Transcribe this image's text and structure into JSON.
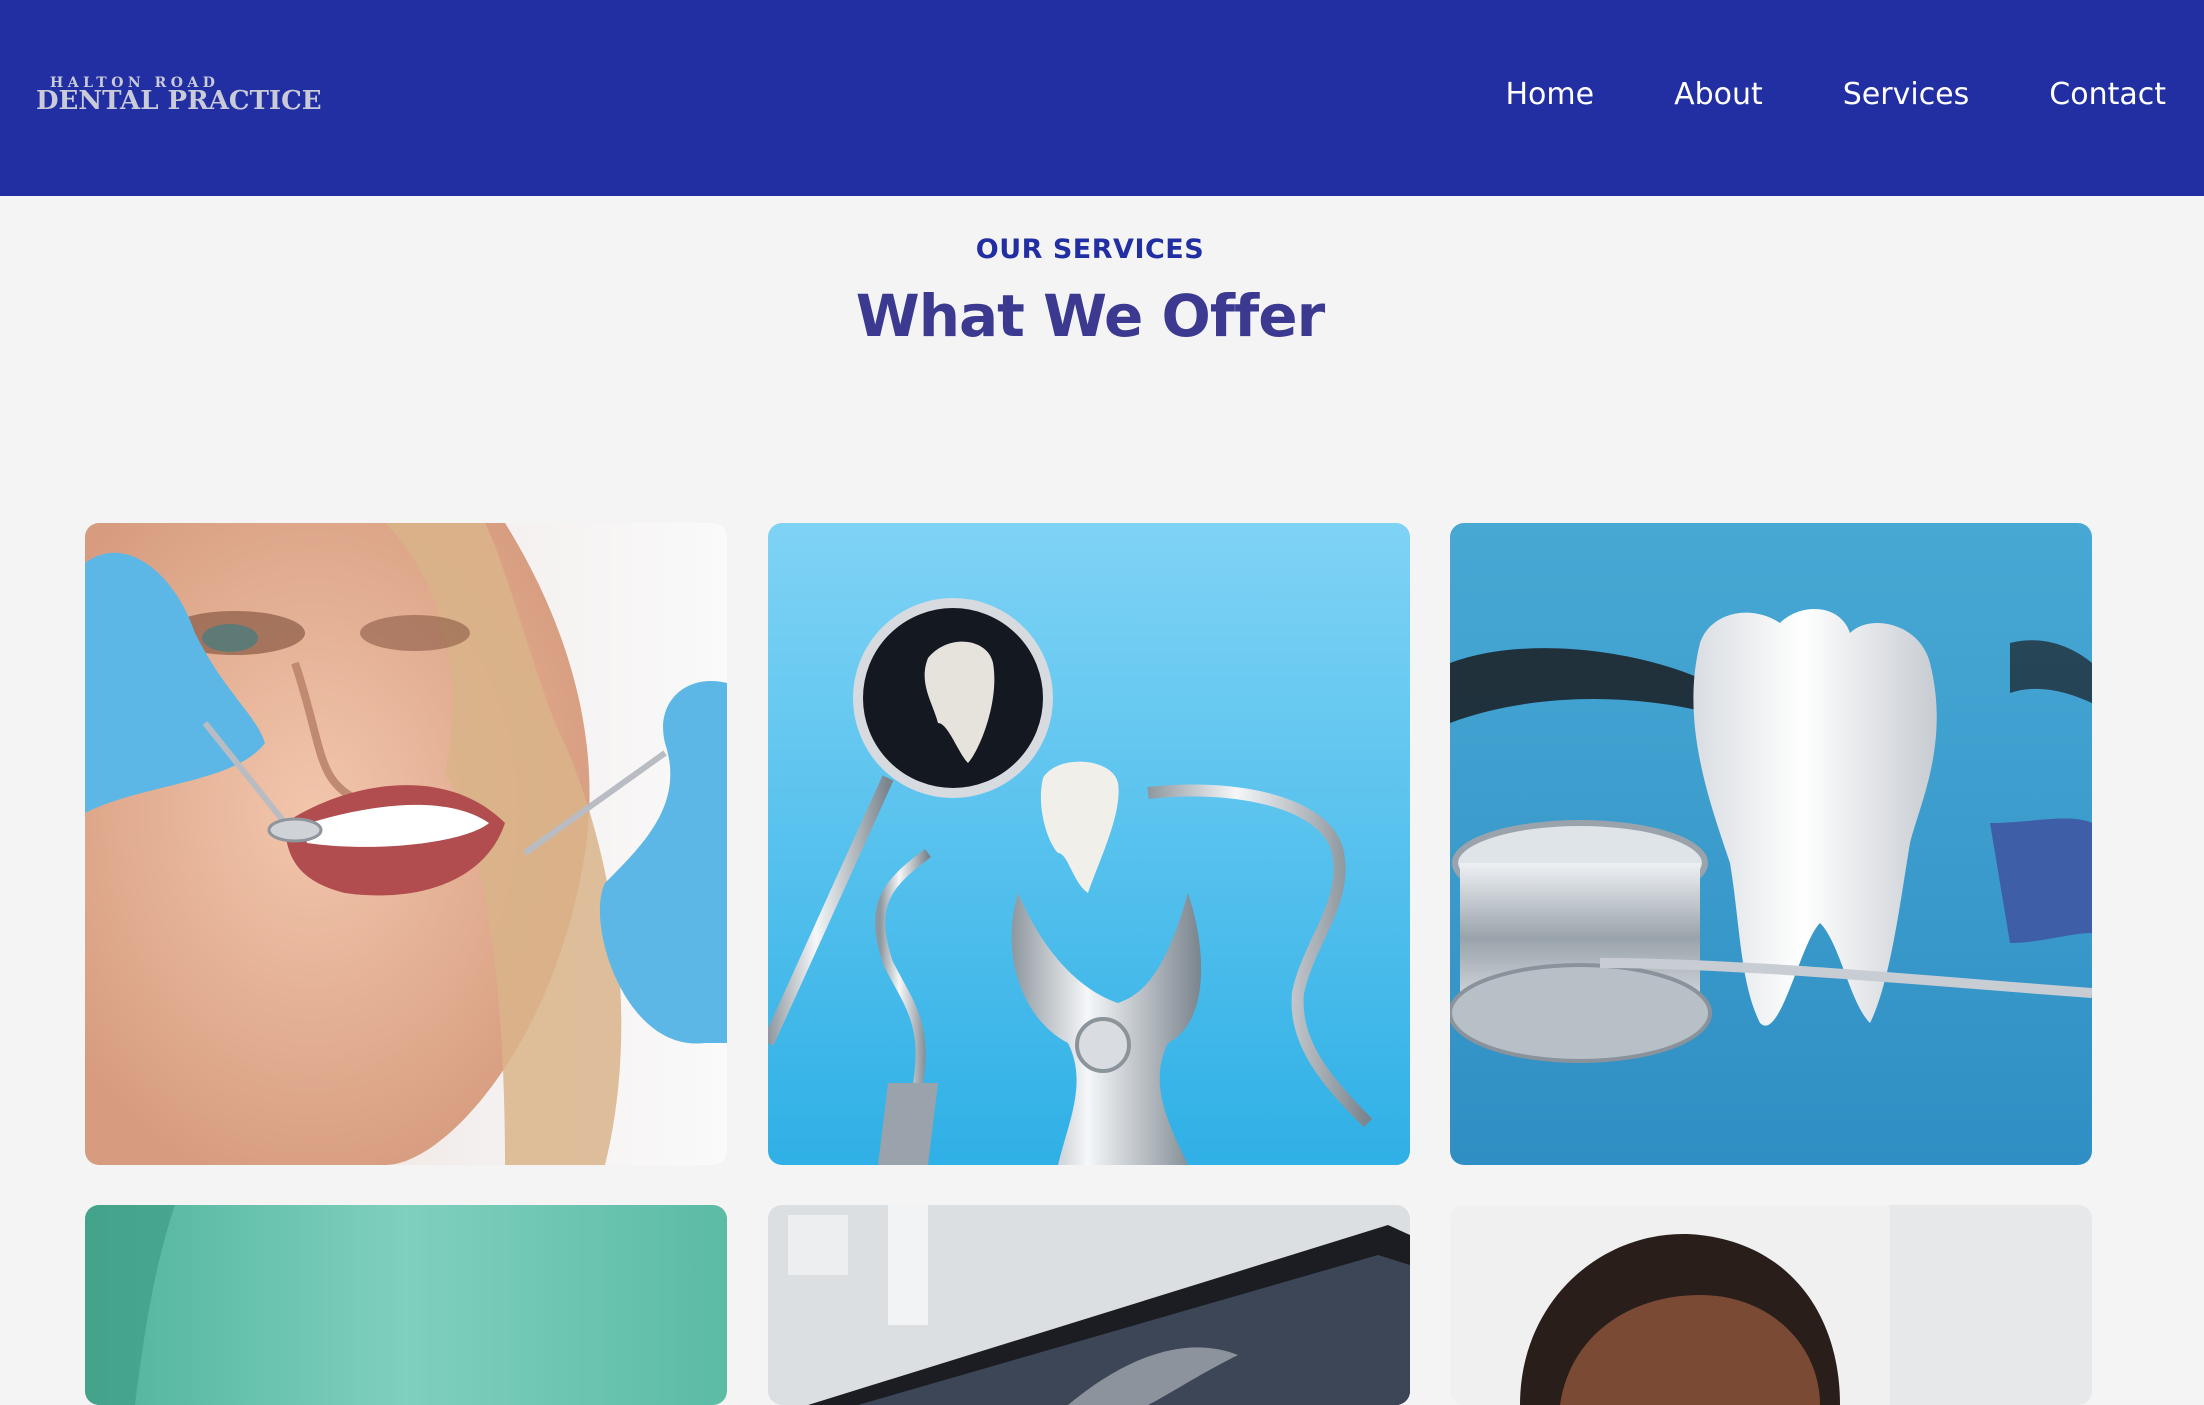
{
  "brand": {
    "logo_line1": "HALTON ROAD",
    "logo_line2": "DENTAL PRACTICE"
  },
  "nav": {
    "items": [
      "Home",
      "About",
      "Services",
      "Contact"
    ]
  },
  "section": {
    "eyebrow": "OUR SERVICES",
    "title": "What We Offer"
  },
  "colors": {
    "header_bg": "#222fa3",
    "page_bg": "#f4f4f4",
    "title": "#3b3990"
  }
}
